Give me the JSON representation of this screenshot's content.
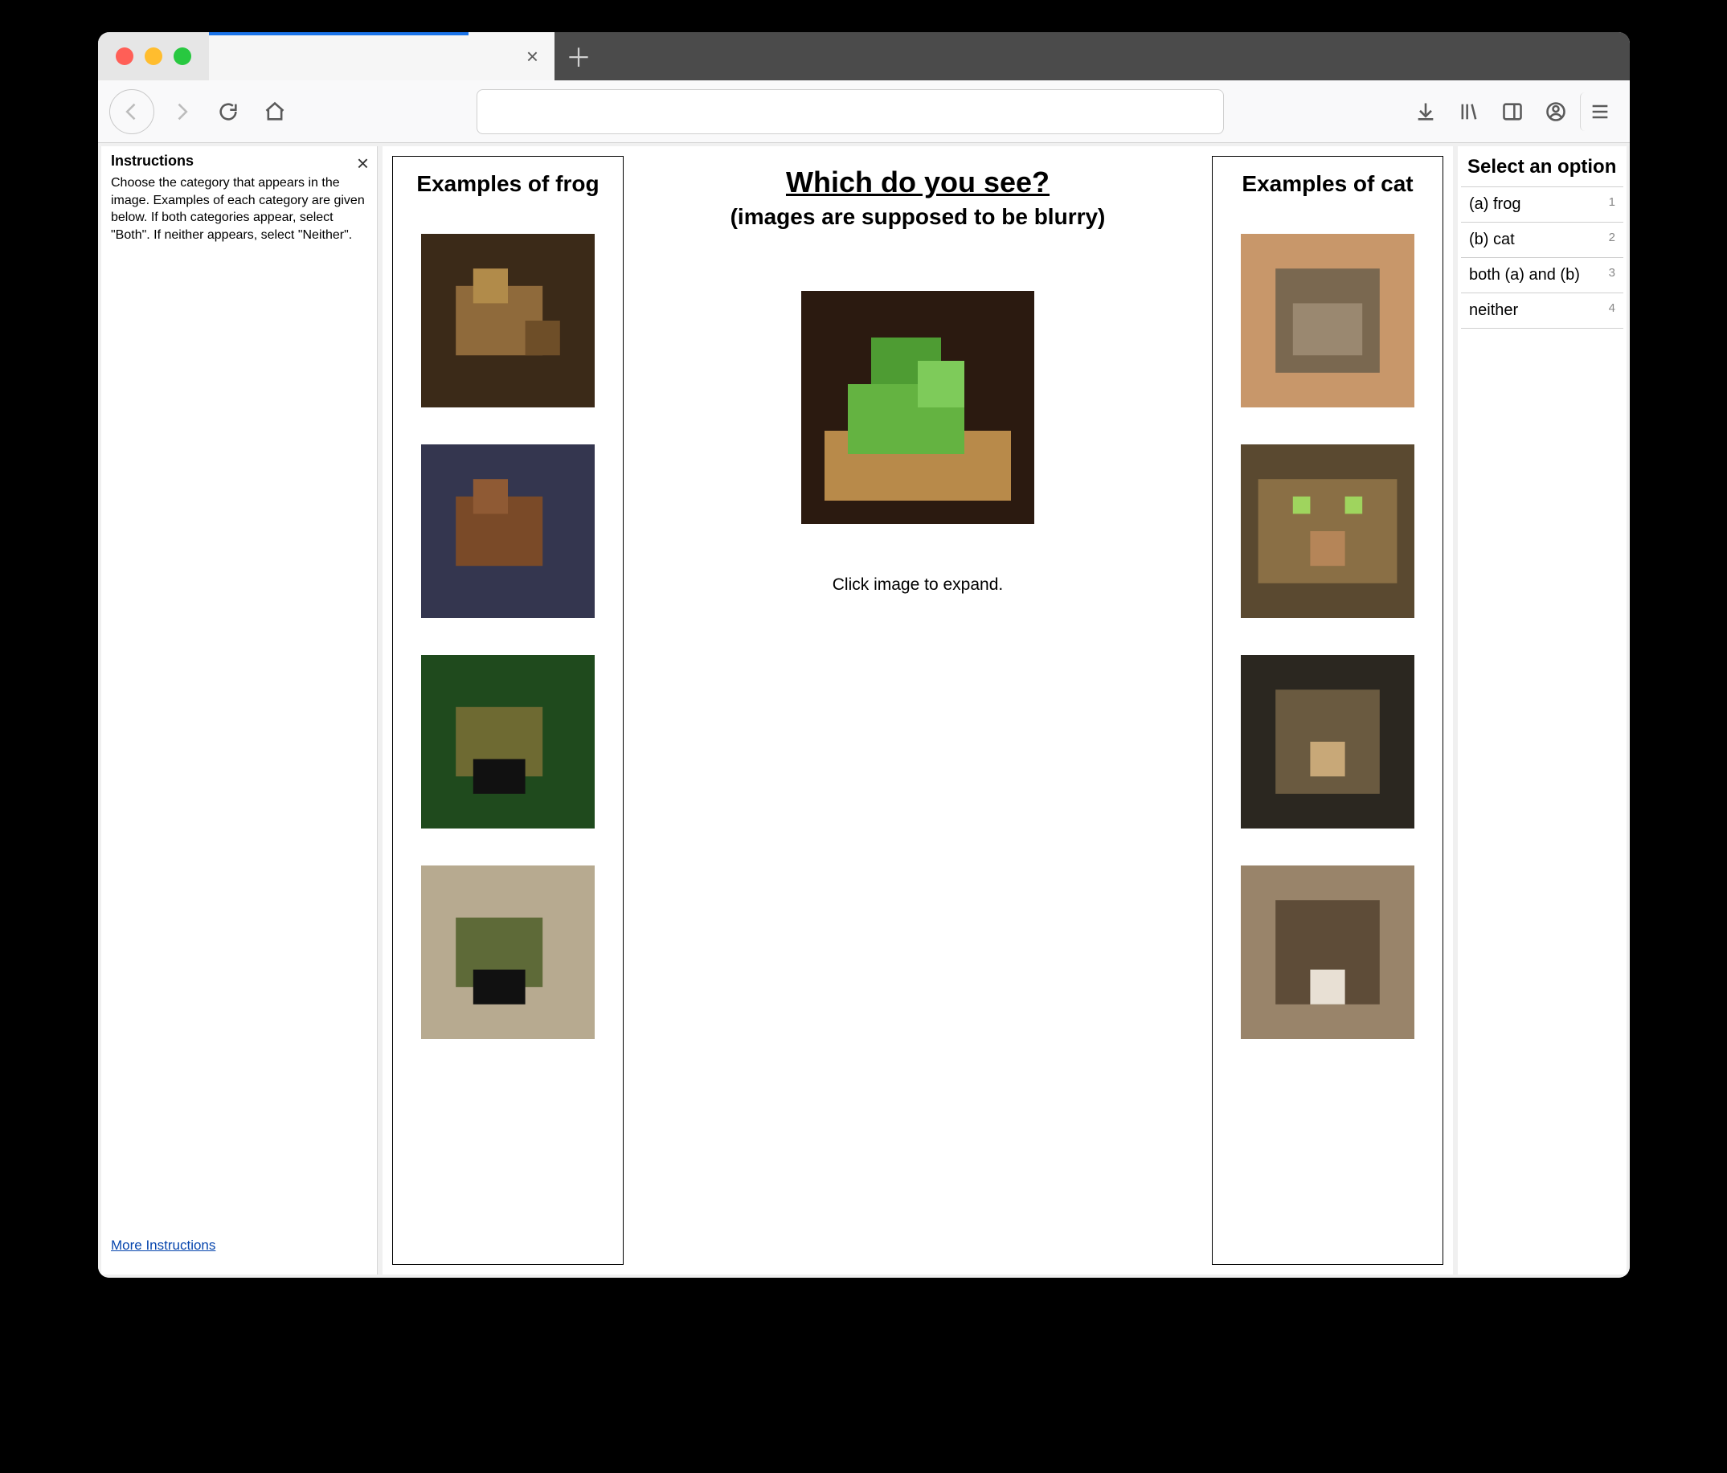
{
  "instructions": {
    "heading": "Instructions",
    "body": "Choose the category that appears in the image. Examples of each category are given below. If both categories appear, select \"Both\". If neither appears, select \"Neither\".",
    "more_link": "More Instructions"
  },
  "columns": {
    "left_heading": "Examples of frog",
    "right_heading": "Examples of cat"
  },
  "center": {
    "title": "Which do you see?",
    "subtitle": "(images are supposed to be blurry)",
    "expand_hint": "Click image to expand."
  },
  "options": {
    "heading": "Select an option",
    "items": [
      {
        "label": "(a) frog",
        "hotkey": "1"
      },
      {
        "label": "(b) cat",
        "hotkey": "2"
      },
      {
        "label": "both (a) and (b)",
        "hotkey": "3"
      },
      {
        "label": "neither",
        "hotkey": "4"
      }
    ]
  }
}
